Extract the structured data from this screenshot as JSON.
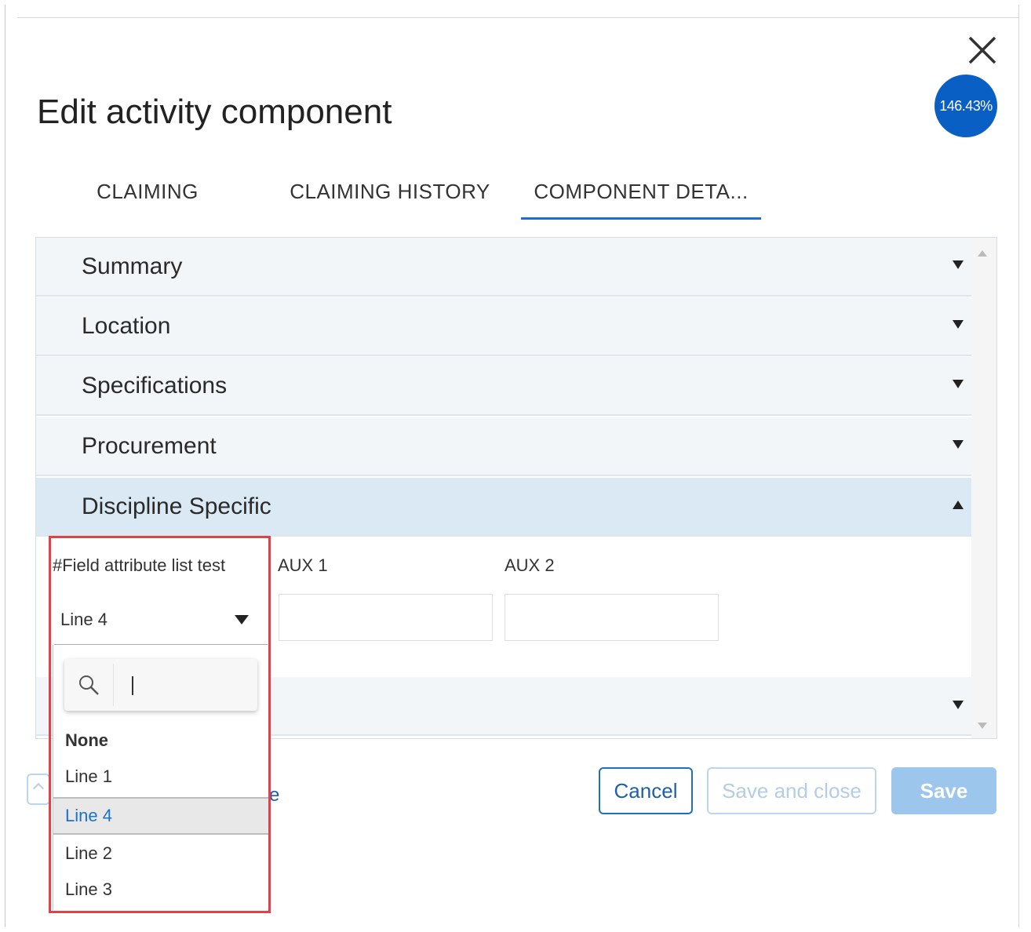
{
  "dialog": {
    "title": "Edit activity component",
    "progress_badge": "146.43%",
    "close_icon": "close-icon"
  },
  "tabs": [
    {
      "label": "CLAIMING",
      "active": false
    },
    {
      "label": "CLAIMING HISTORY",
      "active": false
    },
    {
      "label": "COMPONENT DETA...",
      "active": true
    }
  ],
  "accordion": {
    "sections": [
      {
        "label": "Summary",
        "expanded": false
      },
      {
        "label": "Location",
        "expanded": false
      },
      {
        "label": "Specifications",
        "expanded": false
      },
      {
        "label": "Procurement",
        "expanded": false
      },
      {
        "label": "Discipline Specific",
        "expanded": true
      },
      {
        "label": "",
        "expanded": false
      }
    ]
  },
  "discipline_fields": {
    "field_attribute_label": "#Field attribute list test",
    "field_attribute_value": "Line 4",
    "aux1_label": "AUX 1",
    "aux1_value": "",
    "aux2_label": "AUX 2",
    "aux2_value": ""
  },
  "dropdown": {
    "search_value": "",
    "search_icon": "search-icon",
    "options": [
      {
        "label": "None",
        "bold": true,
        "selected": false
      },
      {
        "label": "Line 1",
        "bold": false,
        "selected": false
      },
      {
        "label": "Line 4",
        "bold": false,
        "selected": true
      },
      {
        "label": "Line 2",
        "bold": false,
        "selected": false
      },
      {
        "label": "Line 3",
        "bold": false,
        "selected": false
      }
    ]
  },
  "footer": {
    "cancel_label": "Cancel",
    "save_close_label": "Save and close",
    "save_label": "Save",
    "partial_link_text": "e"
  },
  "colors": {
    "accent": "#1a6fd0",
    "badge": "#0a5fc4",
    "expanded_section": "#dbe9f5",
    "highlight_border": "#e0424c",
    "disabled_button": "#9cc6ec"
  }
}
